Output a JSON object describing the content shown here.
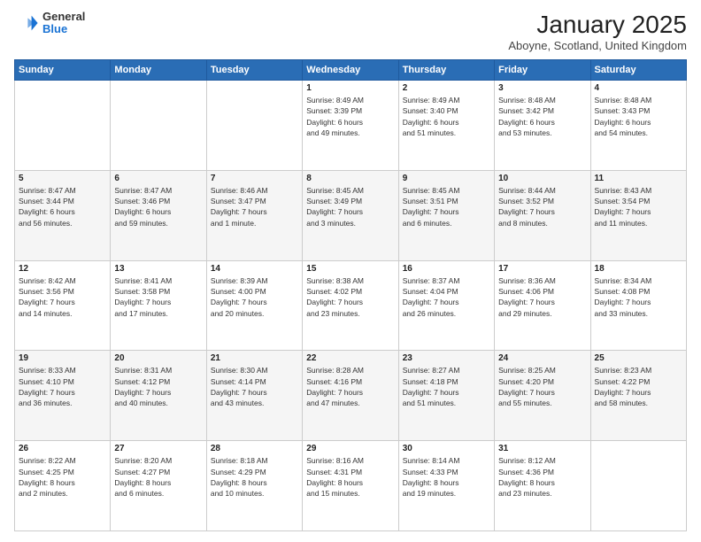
{
  "header": {
    "logo": {
      "general": "General",
      "blue": "Blue"
    },
    "title": "January 2025",
    "location": "Aboyne, Scotland, United Kingdom"
  },
  "days_of_week": [
    "Sunday",
    "Monday",
    "Tuesday",
    "Wednesday",
    "Thursday",
    "Friday",
    "Saturday"
  ],
  "weeks": [
    [
      {
        "day": "",
        "info": ""
      },
      {
        "day": "",
        "info": ""
      },
      {
        "day": "",
        "info": ""
      },
      {
        "day": "1",
        "info": "Sunrise: 8:49 AM\nSunset: 3:39 PM\nDaylight: 6 hours\nand 49 minutes."
      },
      {
        "day": "2",
        "info": "Sunrise: 8:49 AM\nSunset: 3:40 PM\nDaylight: 6 hours\nand 51 minutes."
      },
      {
        "day": "3",
        "info": "Sunrise: 8:48 AM\nSunset: 3:42 PM\nDaylight: 6 hours\nand 53 minutes."
      },
      {
        "day": "4",
        "info": "Sunrise: 8:48 AM\nSunset: 3:43 PM\nDaylight: 6 hours\nand 54 minutes."
      }
    ],
    [
      {
        "day": "5",
        "info": "Sunrise: 8:47 AM\nSunset: 3:44 PM\nDaylight: 6 hours\nand 56 minutes."
      },
      {
        "day": "6",
        "info": "Sunrise: 8:47 AM\nSunset: 3:46 PM\nDaylight: 6 hours\nand 59 minutes."
      },
      {
        "day": "7",
        "info": "Sunrise: 8:46 AM\nSunset: 3:47 PM\nDaylight: 7 hours\nand 1 minute."
      },
      {
        "day": "8",
        "info": "Sunrise: 8:45 AM\nSunset: 3:49 PM\nDaylight: 7 hours\nand 3 minutes."
      },
      {
        "day": "9",
        "info": "Sunrise: 8:45 AM\nSunset: 3:51 PM\nDaylight: 7 hours\nand 6 minutes."
      },
      {
        "day": "10",
        "info": "Sunrise: 8:44 AM\nSunset: 3:52 PM\nDaylight: 7 hours\nand 8 minutes."
      },
      {
        "day": "11",
        "info": "Sunrise: 8:43 AM\nSunset: 3:54 PM\nDaylight: 7 hours\nand 11 minutes."
      }
    ],
    [
      {
        "day": "12",
        "info": "Sunrise: 8:42 AM\nSunset: 3:56 PM\nDaylight: 7 hours\nand 14 minutes."
      },
      {
        "day": "13",
        "info": "Sunrise: 8:41 AM\nSunset: 3:58 PM\nDaylight: 7 hours\nand 17 minutes."
      },
      {
        "day": "14",
        "info": "Sunrise: 8:39 AM\nSunset: 4:00 PM\nDaylight: 7 hours\nand 20 minutes."
      },
      {
        "day": "15",
        "info": "Sunrise: 8:38 AM\nSunset: 4:02 PM\nDaylight: 7 hours\nand 23 minutes."
      },
      {
        "day": "16",
        "info": "Sunrise: 8:37 AM\nSunset: 4:04 PM\nDaylight: 7 hours\nand 26 minutes."
      },
      {
        "day": "17",
        "info": "Sunrise: 8:36 AM\nSunset: 4:06 PM\nDaylight: 7 hours\nand 29 minutes."
      },
      {
        "day": "18",
        "info": "Sunrise: 8:34 AM\nSunset: 4:08 PM\nDaylight: 7 hours\nand 33 minutes."
      }
    ],
    [
      {
        "day": "19",
        "info": "Sunrise: 8:33 AM\nSunset: 4:10 PM\nDaylight: 7 hours\nand 36 minutes."
      },
      {
        "day": "20",
        "info": "Sunrise: 8:31 AM\nSunset: 4:12 PM\nDaylight: 7 hours\nand 40 minutes."
      },
      {
        "day": "21",
        "info": "Sunrise: 8:30 AM\nSunset: 4:14 PM\nDaylight: 7 hours\nand 43 minutes."
      },
      {
        "day": "22",
        "info": "Sunrise: 8:28 AM\nSunset: 4:16 PM\nDaylight: 7 hours\nand 47 minutes."
      },
      {
        "day": "23",
        "info": "Sunrise: 8:27 AM\nSunset: 4:18 PM\nDaylight: 7 hours\nand 51 minutes."
      },
      {
        "day": "24",
        "info": "Sunrise: 8:25 AM\nSunset: 4:20 PM\nDaylight: 7 hours\nand 55 minutes."
      },
      {
        "day": "25",
        "info": "Sunrise: 8:23 AM\nSunset: 4:22 PM\nDaylight: 7 hours\nand 58 minutes."
      }
    ],
    [
      {
        "day": "26",
        "info": "Sunrise: 8:22 AM\nSunset: 4:25 PM\nDaylight: 8 hours\nand 2 minutes."
      },
      {
        "day": "27",
        "info": "Sunrise: 8:20 AM\nSunset: 4:27 PM\nDaylight: 8 hours\nand 6 minutes."
      },
      {
        "day": "28",
        "info": "Sunrise: 8:18 AM\nSunset: 4:29 PM\nDaylight: 8 hours\nand 10 minutes."
      },
      {
        "day": "29",
        "info": "Sunrise: 8:16 AM\nSunset: 4:31 PM\nDaylight: 8 hours\nand 15 minutes."
      },
      {
        "day": "30",
        "info": "Sunrise: 8:14 AM\nSunset: 4:33 PM\nDaylight: 8 hours\nand 19 minutes."
      },
      {
        "day": "31",
        "info": "Sunrise: 8:12 AM\nSunset: 4:36 PM\nDaylight: 8 hours\nand 23 minutes."
      },
      {
        "day": "",
        "info": ""
      }
    ]
  ]
}
